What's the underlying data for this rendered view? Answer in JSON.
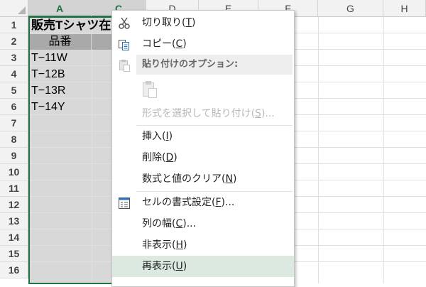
{
  "sheet": {
    "columns": [
      "A",
      "C",
      "D",
      "E",
      "F",
      "G",
      "H"
    ],
    "rows": [
      "1",
      "2",
      "3",
      "4",
      "5",
      "6",
      "7",
      "8",
      "9",
      "10",
      "11",
      "12",
      "13",
      "14",
      "15",
      "16"
    ],
    "title": "販売Tシャツ在",
    "header": "品番",
    "codes": [
      "T−11W",
      "T−12B",
      "T−13R",
      "T−14Y"
    ]
  },
  "context_menu": {
    "items": {
      "cut": {
        "label": "切り取り(",
        "key": "T",
        "end": ")"
      },
      "copy": {
        "label": "コピー(",
        "key": "C",
        "end": ")"
      },
      "paste_options": {
        "label": "貼り付けのオプション:"
      },
      "paste_special": {
        "label": "形式を選択して貼り付け(",
        "key": "S",
        "end": ")..."
      },
      "insert": {
        "label": "挿入(",
        "key": "I",
        "end": ")"
      },
      "delete": {
        "label": "削除(",
        "key": "D",
        "end": ")"
      },
      "clear": {
        "label": "数式と値のクリア(",
        "key": "N",
        "end": ")"
      },
      "format_cells": {
        "label": "セルの書式設定(",
        "key": "F",
        "end": ")..."
      },
      "column_width": {
        "label": "列の幅(",
        "key": "C",
        "end": ")..."
      },
      "hide": {
        "label": "非表示(",
        "key": "H",
        "end": ")"
      },
      "unhide": {
        "label": "再表示(",
        "key": "U",
        "end": ")"
      }
    }
  },
  "colors": {
    "accent": "#217346",
    "hover": "#dbe9e0",
    "selection": "#d8d8d8"
  }
}
